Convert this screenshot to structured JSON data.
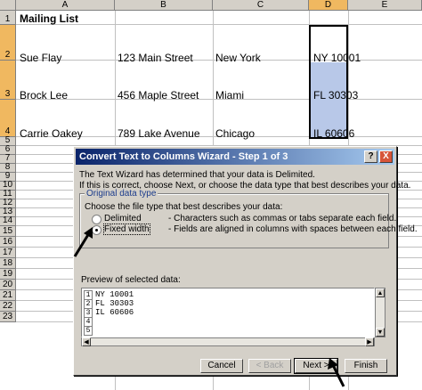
{
  "spreadsheet": {
    "columns": [
      "A",
      "B",
      "C",
      "D",
      "E"
    ],
    "selected_column": "D",
    "rows": [
      "1",
      "2",
      "3",
      "4",
      "5",
      "6",
      "7",
      "8",
      "9",
      "10",
      "11",
      "12",
      "13",
      "14",
      "15",
      "16",
      "17",
      "18",
      "19",
      "20",
      "21",
      "22",
      "23"
    ],
    "title_cell": "Mailing List",
    "data": [
      {
        "name": "Sue Flay",
        "street": "123 Main Street",
        "city": "New York",
        "state_zip": "NY 10001"
      },
      {
        "name": "Brock Lee",
        "street": "456 Maple Street",
        "city": "Miami",
        "state_zip": "FL 30303"
      },
      {
        "name": "Carrie Oakey",
        "street": "789 Lake Avenue",
        "city": "Chicago",
        "state_zip": "IL 60606"
      }
    ]
  },
  "dialog": {
    "title": "Convert Text to Columns Wizard - Step 1 of 3",
    "help_label": "?",
    "close_label": "X",
    "intro_line1": "The Text Wizard has determined that your data is Delimited.",
    "intro_line2": "If this is correct, choose Next, or choose the data type that best describes your data.",
    "group_label": "Original data type",
    "choose_prompt": "Choose the file type that best describes your data:",
    "options": [
      {
        "label": "Delimited",
        "desc": "- Characters such as commas or tabs separate each field.",
        "selected": false
      },
      {
        "label": "Fixed width",
        "desc": "- Fields are aligned in columns with spaces between each field.",
        "selected": true
      }
    ],
    "preview_label": "Preview of selected data:",
    "preview_lines": [
      {
        "num": "1",
        "text": "NY 10001"
      },
      {
        "num": "2",
        "text": "FL 30303"
      },
      {
        "num": "3",
        "text": "IL 60606"
      },
      {
        "num": "4",
        "text": ""
      },
      {
        "num": "5",
        "text": ""
      }
    ],
    "buttons": {
      "cancel": "Cancel",
      "back": "< Back",
      "next": "Next >",
      "finish": "Finish"
    }
  }
}
